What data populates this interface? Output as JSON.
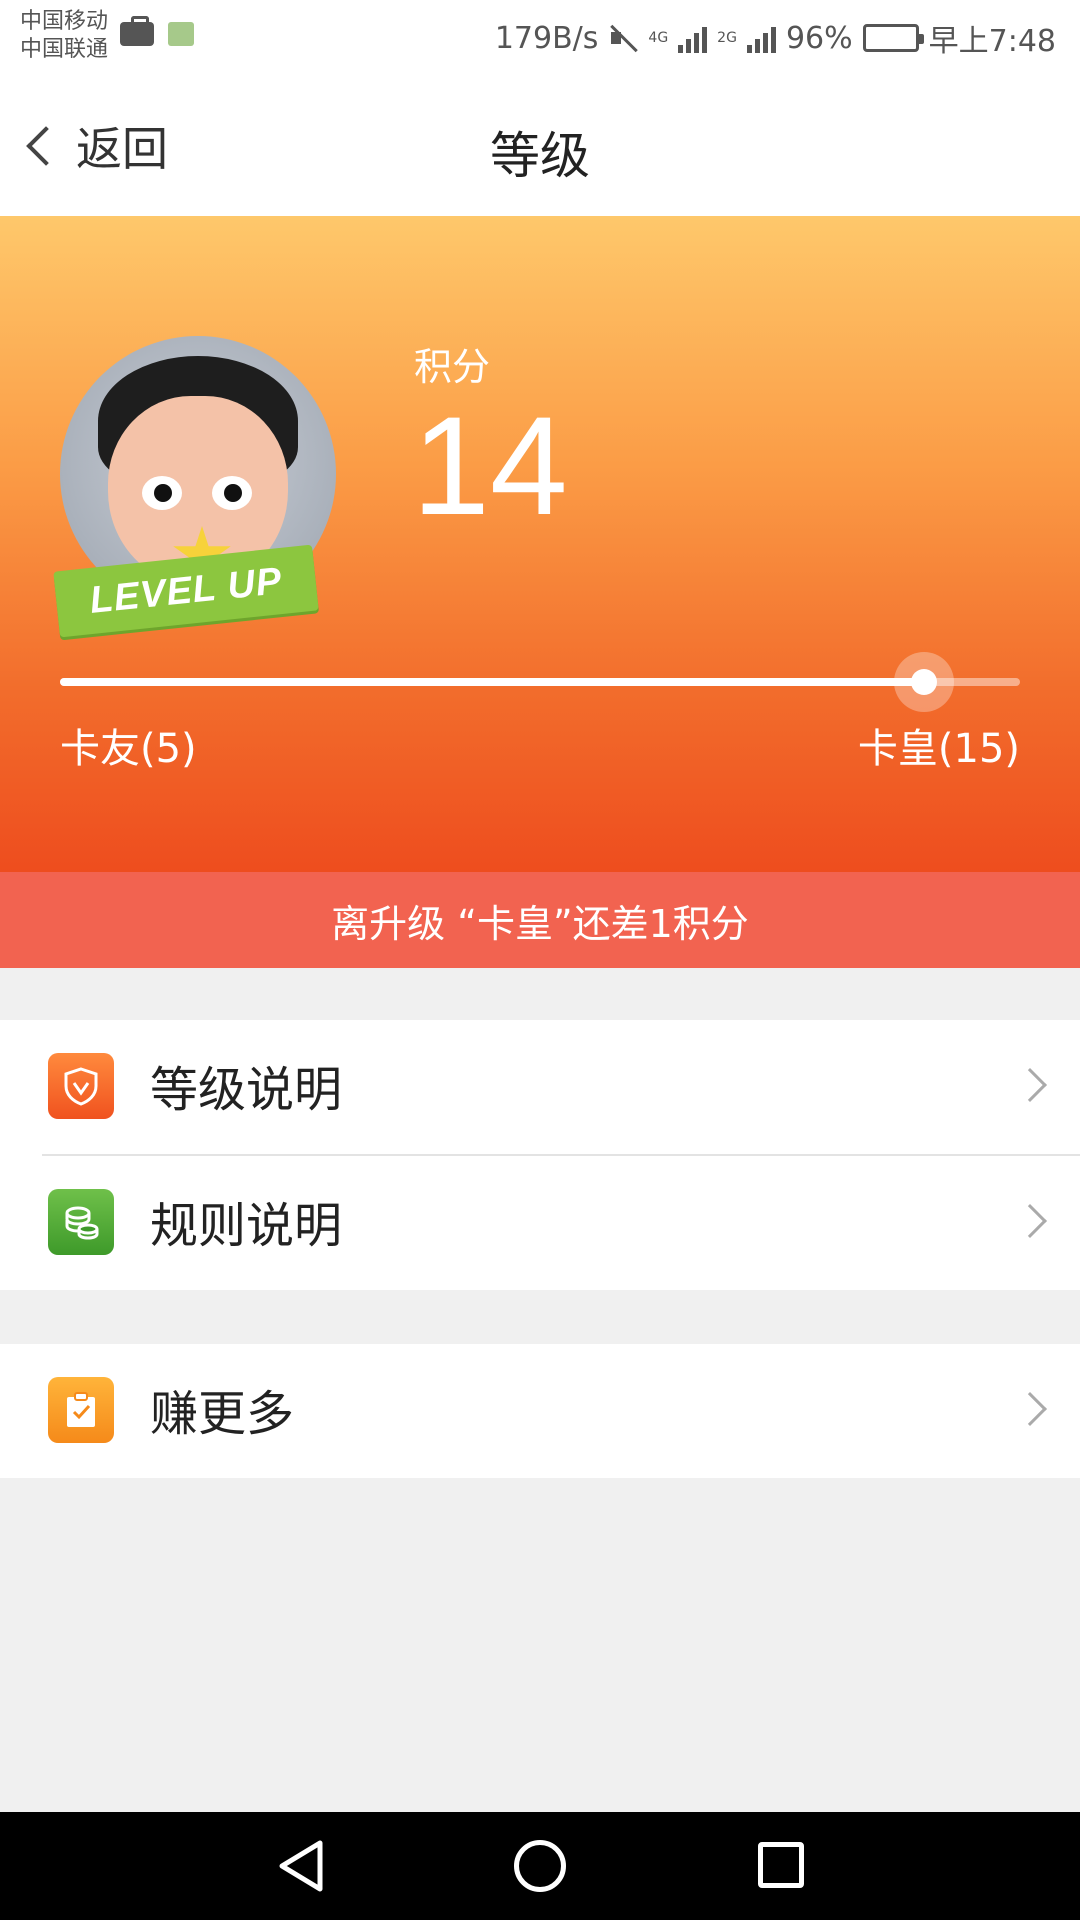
{
  "status_bar": {
    "carrier_1": "中国移动",
    "carrier_2": "中国联通",
    "network_speed": "179B/s",
    "network_1": "4G",
    "network_2": "2G",
    "battery": "96%",
    "battery_level": 0.96,
    "time": "早上7:48"
  },
  "nav": {
    "back_label": "返回",
    "title": "等级"
  },
  "hero": {
    "avatar_badge": "LEVEL UP",
    "score_label": "积分",
    "score_value": "14",
    "progress": {
      "current": 14,
      "min": 5,
      "max": 15
    },
    "level_from": "卡友(5)",
    "level_to": "卡皇(15)",
    "upgrade_hint": "离升级 “卡皇”还差1积分"
  },
  "menu": {
    "items": [
      {
        "label": "等级说明",
        "icon": "shield-icon"
      },
      {
        "label": "规则说明",
        "icon": "coins-icon"
      },
      {
        "label": "赚更多",
        "icon": "clipboard-check-icon"
      }
    ]
  },
  "colors": {
    "hero_top": "#fec86b",
    "hero_bottom": "#ee4d1e",
    "upgrade_bar": "#f26350"
  }
}
